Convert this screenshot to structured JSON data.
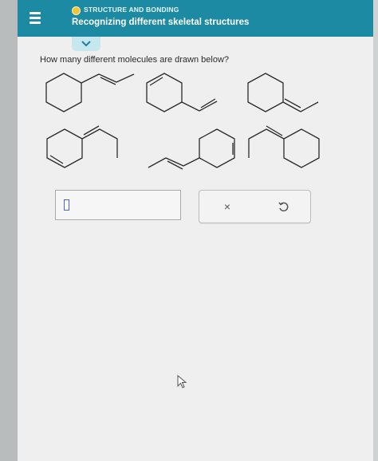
{
  "header": {
    "topic_label": "STRUCTURE AND BONDING",
    "lesson_title": "Recognizing different skeletal structures",
    "accent_color": "#1c8aa3",
    "status_color": "#f0c33a"
  },
  "question": {
    "prompt": "How many different molecules are drawn below?"
  },
  "answer": {
    "value": ""
  },
  "buttons": {
    "clear_label": "×",
    "undo_icon": "undo-icon"
  },
  "icons": {
    "menu": "menu-icon",
    "collapse": "chevron-down-icon",
    "cursor": "mouse-pointer-icon"
  }
}
